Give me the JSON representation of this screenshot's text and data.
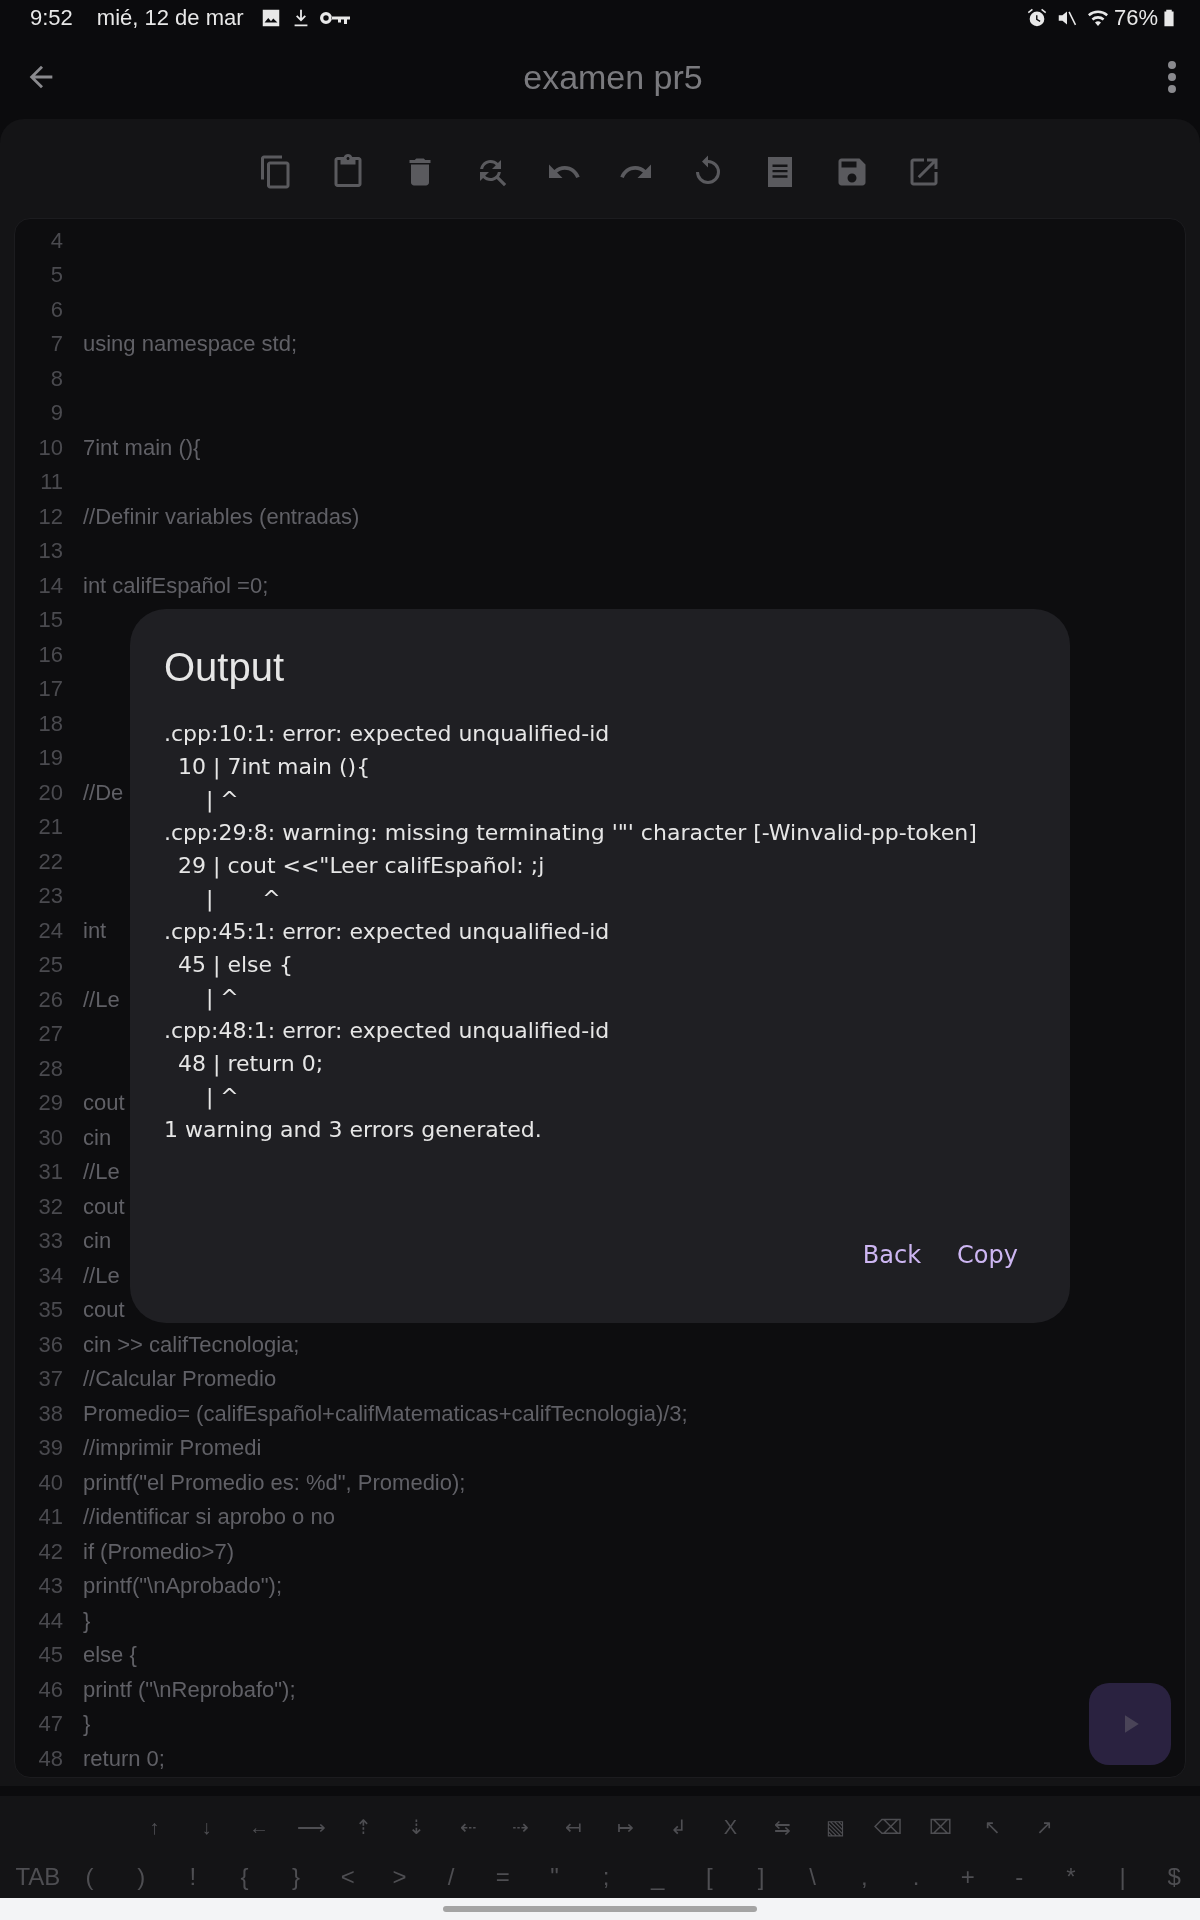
{
  "status_bar": {
    "time": "9:52",
    "date": "mié, 12 de mar",
    "battery": "76%"
  },
  "app_bar": {
    "title": "examen pr5"
  },
  "editor": {
    "lines": [
      {
        "number": "4"
      },
      {
        "number": "5"
      },
      {
        "number": "6"
      },
      {
        "number": "7",
        "text": "using namespace std;"
      },
      {
        "number": "8"
      },
      {
        "number": "9"
      },
      {
        "number": "10",
        "text": "7int main (){"
      },
      {
        "number": "11"
      },
      {
        "number": "12",
        "text": "//Definir variables (entradas)"
      },
      {
        "number": "13"
      },
      {
        "number": "14",
        "text": "int califEspañol =0;"
      },
      {
        "number": "15"
      },
      {
        "number": "16"
      },
      {
        "number": "17"
      },
      {
        "number": "18"
      },
      {
        "number": "19"
      },
      {
        "number": "20",
        "text": "//De"
      },
      {
        "number": "21"
      },
      {
        "number": "22"
      },
      {
        "number": "23"
      },
      {
        "number": "24",
        "text": "int"
      },
      {
        "number": "25"
      },
      {
        "number": "26",
        "text": "//Le"
      },
      {
        "number": "27"
      },
      {
        "number": "28"
      },
      {
        "number": "29",
        "text": "cout"
      },
      {
        "number": "30",
        "text": "cin"
      },
      {
        "number": "31",
        "text": "//Le"
      },
      {
        "number": "32",
        "text": "cout"
      },
      {
        "number": "33",
        "text": "cin"
      },
      {
        "number": "34",
        "text": "//Le"
      },
      {
        "number": "35",
        "text": "cout"
      },
      {
        "number": "36",
        "text": "cin >> califTecnologia;"
      },
      {
        "number": "37",
        "text": "//Calcular Promedio"
      },
      {
        "number": "38",
        "text": "Promedio= (califEspañol+califMatematicas+califTecnologia)/3;"
      },
      {
        "number": "39",
        "text": "//imprimir Promedi"
      },
      {
        "number": "40",
        "text": "printf(\"el Promedio es: %d\", Promedio);"
      },
      {
        "number": "41",
        "text": "//identificar si aprobo o no"
      },
      {
        "number": "42",
        "text": "if (Promedio>7)"
      },
      {
        "number": "43",
        "text": "printf(\"\\nAprobado\");"
      },
      {
        "number": "44",
        "text": "}"
      },
      {
        "number": "45",
        "text": "else {"
      },
      {
        "number": "46",
        "text": "printf (\"\\nReprobafo\");"
      },
      {
        "number": "47",
        "text": "}"
      },
      {
        "number": "48",
        "text": "return 0;"
      }
    ]
  },
  "dialog": {
    "title": "Output",
    "output_lines": [
      ".cpp:10:1: error: expected unqualified-id",
      "  10 | 7int main (){",
      "      | ^",
      ".cpp:29:8: warning: missing terminating '\"' character [-Winvalid-pp-token]",
      "  29 | cout <<\"Leer califEspañol: ;j",
      "      |       ^",
      ".cpp:45:1: error: expected unqualified-id",
      "  45 | else {",
      "      | ^",
      ".cpp:48:1: error: expected unqualified-id",
      "  48 | return 0;",
      "      | ^",
      "1 warning and 3 errors generated."
    ],
    "buttons": [
      "Back",
      "Copy"
    ]
  },
  "keyboard_bar": {
    "row_1": [
      "↑",
      "↓",
      "←",
      "⟶",
      "⇡",
      "⇣",
      "⇠",
      "⇢",
      "↤",
      "↦",
      "↲",
      "X",
      "⇆",
      "▧",
      "⌫",
      "⌧",
      "↖",
      "↗"
    ],
    "row_2": [
      "TAB",
      "(",
      ")",
      "!",
      "{",
      "}",
      "<",
      ">",
      "/",
      "=",
      "\"",
      ";",
      "_",
      "[",
      "]",
      "\\",
      ",",
      ".",
      "+",
      "-",
      "*",
      "|",
      "$"
    ]
  }
}
